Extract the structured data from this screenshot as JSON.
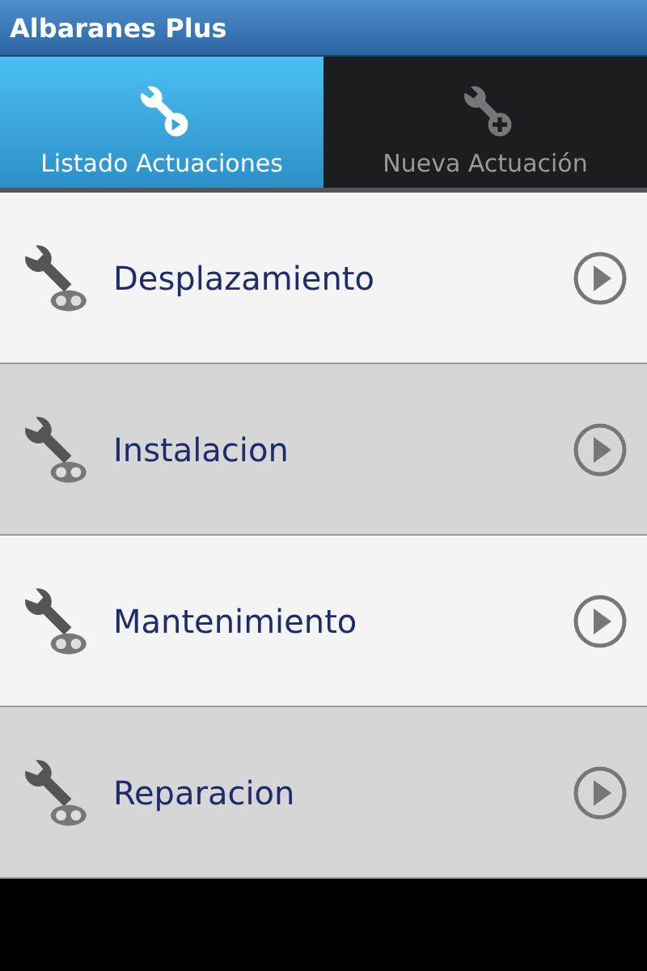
{
  "window": {
    "title": "Albaranes Plus"
  },
  "tabs": [
    {
      "label": "Listado Actuaciones",
      "selected": true,
      "kind": "list"
    },
    {
      "label": "Nueva Actuación",
      "selected": false,
      "kind": "add"
    }
  ],
  "items": [
    {
      "label": "Desplazamiento"
    },
    {
      "label": "Instalacion"
    },
    {
      "label": "Mantenimiento"
    },
    {
      "label": "Reparacion"
    }
  ]
}
